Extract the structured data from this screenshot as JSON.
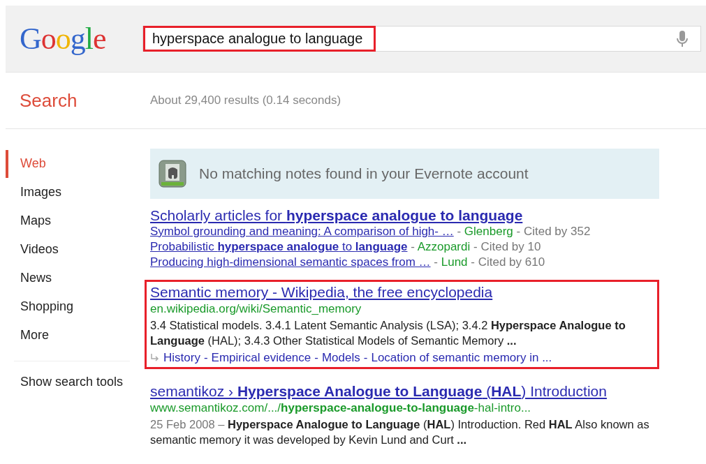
{
  "header": {
    "logo": "Google",
    "search": {
      "value": "hyperspace analogue to language",
      "highlighted": true
    }
  },
  "title": "Search",
  "result_stats": "About 29,400 results (0.14 seconds)",
  "sidebar": {
    "items": [
      {
        "label": "Web",
        "selected": true
      },
      {
        "label": "Images",
        "selected": false
      },
      {
        "label": "Maps",
        "selected": false
      },
      {
        "label": "Videos",
        "selected": false
      },
      {
        "label": "News",
        "selected": false
      },
      {
        "label": "Shopping",
        "selected": false
      },
      {
        "label": "More",
        "selected": false
      }
    ],
    "tools": "Show search tools"
  },
  "evernote_notice": "No matching notes found in your Evernote account",
  "results": [
    {
      "kind": "scholarly",
      "separator": "-",
      "title": "Scholarly articles for **hyperspace analogue to language**",
      "highlighted": false,
      "articles": [
        {
          "title": "Symbol grounding and meaning: A comparison of high- …",
          "author": "Glenberg",
          "cited": "Cited by 352"
        },
        {
          "title": "Probabilistic **hyperspace analogue** to **language**",
          "author": "Azzopardi",
          "cited": "Cited by 10"
        },
        {
          "title": "Producing high-dimensional semantic spaces from …",
          "author": "Lund",
          "cited": "Cited by 610"
        }
      ]
    },
    {
      "kind": "web",
      "separator": "-",
      "title": "Semantic memory - Wikipedia, the free encyclopedia",
      "highlighted": true,
      "url": "en.wikipedia.org/wiki/Semantic_memory",
      "snippet": "3.4 Statistical models. 3.4.1 Latent Semantic Analysis (LSA); 3.4.2 **Hyperspace Analogue to Language** (HAL); 3.4.3 Other Statistical Models of Semantic Memory **...**",
      "sitelinks": [
        "History",
        "Empirical evidence",
        "Models",
        "Location of semantic memory in ..."
      ]
    },
    {
      "kind": "web",
      "title": "semantikoz › **Hyperspace Analogue to Language** (**HAL**) Introduction",
      "highlighted": false,
      "url": "www.semantikoz.com/.../**hyperspace-analogue-to-language**-hal-intro...",
      "date": "25 Feb 2008 –",
      "snippet": "**Hyperspace Analogue to Language** (**HAL**) Introduction. Red **HAL** Also known as semantic memory it was developed by Kevin Lund and Curt **...**"
    }
  ]
}
